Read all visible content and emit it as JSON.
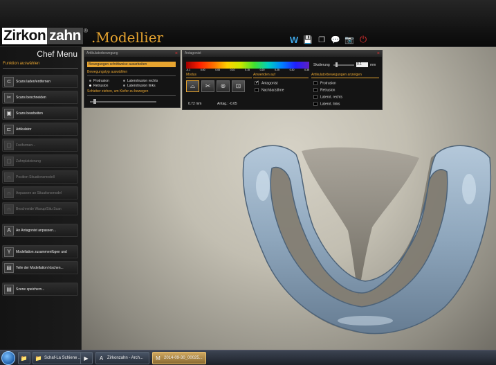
{
  "header": {
    "logo_left": "Zirkon",
    "logo_right": "zahn",
    "logo_reg": "®",
    "app_title": ".Modellier",
    "toolbar": [
      {
        "name": "w-logo-icon",
        "glyph": "W"
      },
      {
        "name": "save-icon",
        "glyph": "💾"
      },
      {
        "name": "copy-icon",
        "glyph": "❐"
      },
      {
        "name": "chat-icon",
        "glyph": "💬"
      },
      {
        "name": "camera-icon",
        "glyph": "📷"
      },
      {
        "name": "power-icon",
        "glyph": "⏻"
      }
    ]
  },
  "sidebar": {
    "title": "Chef Menu",
    "subtitle": "Funktion auswählen",
    "items": [
      {
        "label": "Scans laden/entfernen",
        "icon": "scan-load-icon",
        "glyph": "⊂",
        "enabled": true
      },
      {
        "label": "Scans beschneiden",
        "icon": "scissors-icon",
        "glyph": "✂",
        "enabled": true
      },
      {
        "label": "Scans bearbeiten",
        "icon": "scan-edit-icon",
        "glyph": "▣",
        "enabled": true
      },
      {
        "label": "Artikulator",
        "icon": "articulator-icon",
        "glyph": "⊏",
        "enabled": true
      },
      {
        "label": "Freiformen...",
        "icon": "freeform-icon",
        "glyph": "▢",
        "enabled": false
      },
      {
        "label": "Zahnplatzierung",
        "icon": "tooth-placement-icon",
        "glyph": "▢",
        "enabled": false
      },
      {
        "label": "Position Situationsmodell",
        "icon": "position-icon",
        "glyph": "∩",
        "enabled": false
      },
      {
        "label": "Anpassen an Situationsmodel",
        "icon": "adapt-icon",
        "glyph": "∩",
        "enabled": false
      },
      {
        "label": "Beschneide Waxup/Situ Scan",
        "icon": "trim-icon",
        "glyph": "∩",
        "enabled": false
      },
      {
        "label": "An Antagonist anpassen...",
        "icon": "antagonist-icon",
        "glyph": "A",
        "enabled": true
      },
      {
        "label": "Modellation zusammenfügen und",
        "icon": "merge-icon",
        "glyph": "Y",
        "enabled": true
      },
      {
        "label": "Teile der Modellation löschen...",
        "icon": "delete-parts-icon",
        "glyph": "▤",
        "enabled": true
      },
      {
        "label": "Szene speichern...",
        "icon": "save-scene-icon",
        "glyph": "▤",
        "enabled": true
      }
    ]
  },
  "articulator_panel": {
    "title": "Artikulatorbewegung",
    "close": "×",
    "button": "Bewegungen schrittweise ausarbeiten",
    "section1": "Bewegungstyp auswählen",
    "options": [
      {
        "label": "Protrusion",
        "selected": false
      },
      {
        "label": "Laterotrusion rechts",
        "selected": false
      },
      {
        "label": "Retrusion",
        "selected": true
      },
      {
        "label": "Laterotrusion links",
        "selected": false
      }
    ],
    "section2": "Schieber ziehen, um Kiefer zu bewegen",
    "slider_value": 0.05
  },
  "antagonist_panel": {
    "title": "Antagonist",
    "close": "×",
    "colorbar_ticks": [
      "-0.1",
      "0.00",
      "0.05",
      "0.10",
      "0.15",
      "0.20",
      "0.25",
      "0.30",
      "0.35"
    ],
    "scale_label": "Skalierung",
    "scale_value": "0.1",
    "scale_unit": "mm",
    "scale_slider": 0.1,
    "sec_modus": "Modus",
    "sec_anwenden": "Anwenden auf",
    "sec_anzeigen": "Artikulatorbewegungen anzeigen",
    "modus_buttons": [
      {
        "name": "modus-surface-button",
        "glyph": "⌓",
        "active": true
      },
      {
        "name": "modus-cut-button",
        "glyph": "✂",
        "active": false
      },
      {
        "name": "modus-contact-button",
        "glyph": "⊚",
        "active": false
      },
      {
        "name": "modus-point-button",
        "glyph": "⊡",
        "active": false
      }
    ],
    "apply_to": [
      {
        "label": "Antagonist",
        "checked": true
      },
      {
        "label": "Nachbarzähne",
        "checked": false
      }
    ],
    "show_moves": [
      {
        "label": "Protrusion",
        "checked": false
      },
      {
        "label": "Retrusion",
        "checked": false
      },
      {
        "label": "Laterot. rechts",
        "checked": false
      },
      {
        "label": "Laterot. links",
        "checked": false
      }
    ],
    "distance": "0.72 mm",
    "antag_value": "Antag.: -0.05"
  },
  "taskbar": {
    "items": [
      {
        "label": "",
        "name": "taskbar-folder-a",
        "glyph": "📁",
        "active": false
      },
      {
        "label": "Schaf-La Schiene ...",
        "name": "taskbar-folder-b",
        "glyph": "📁",
        "active": false
      },
      {
        "label": "",
        "name": "taskbar-media",
        "glyph": "▶",
        "active": false
      },
      {
        "label": "Zirkonzahn - Arch...",
        "name": "taskbar-zirkonzahn",
        "glyph": "A",
        "active": false
      },
      {
        "label": "2014-09-30_00025...",
        "name": "taskbar-modellier",
        "glyph": "M",
        "active": true
      }
    ]
  }
}
